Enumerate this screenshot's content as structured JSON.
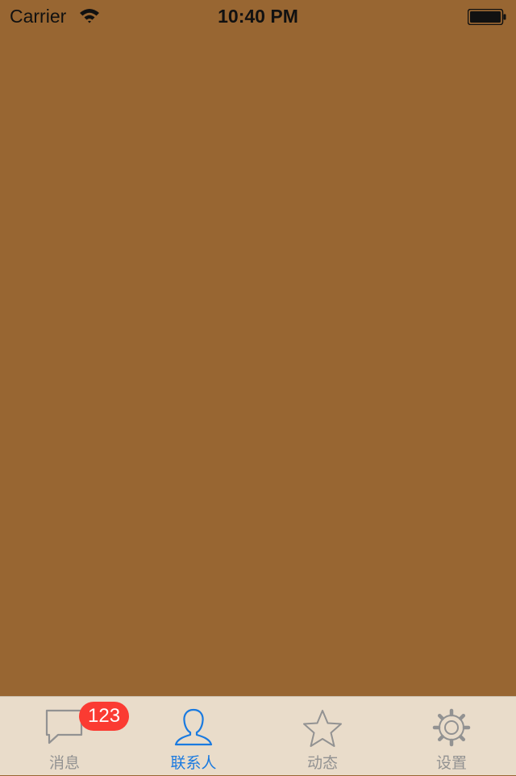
{
  "status_bar": {
    "carrier": "Carrier",
    "time": "10:40 PM",
    "wifi_icon": "wifi-icon",
    "battery_icon": "battery-full-icon"
  },
  "content": {
    "background": "#986632"
  },
  "tab_bar": {
    "background": "#e9dcca",
    "active_color": "#1a7ae0",
    "inactive_color": "#929292",
    "tabs": [
      {
        "label": "消息",
        "icon": "chat-bubble-icon",
        "badge": "123",
        "badge_color": "#fb3b32"
      },
      {
        "label": "联系人",
        "icon": "person-icon",
        "active": true
      },
      {
        "label": "动态",
        "icon": "star-icon"
      },
      {
        "label": "设置",
        "icon": "gear-icon"
      }
    ]
  }
}
